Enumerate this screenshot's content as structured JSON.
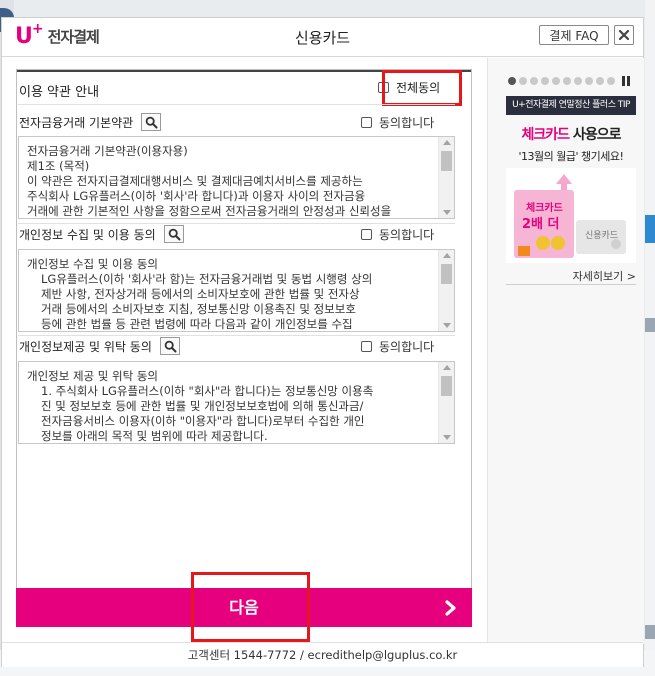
{
  "header": {
    "logo_u": "U",
    "logo_plus": "+",
    "logo_text": "전자결제",
    "title": "신용카드",
    "faq_label": "결제 FAQ"
  },
  "terms": {
    "section_title": "이용 약관 안내",
    "all_agree_label": "전체동의",
    "items": [
      {
        "title": "전자금융거래 기본약관",
        "agree_label": "동의합니다",
        "lines": [
          "전자금융거래 기본약관(이용자용)",
          "제1조 (목적)",
          "이 약관은 전자지급결제대행서비스 및 결제대금예치서비스를 제공하는",
          "주식회사 LG유플러스(이하 '회사'라 합니다)과 이용자 사이의 전자금융",
          "거래에 관한 기본적인 사항을 정함으로써 전자금융거래의 안정성과 신뢰성을"
        ]
      },
      {
        "title": "개인정보 수집 및 이용 동의",
        "agree_label": "동의합니다",
        "lines": [
          "개인정보 수집 및 이용 동의",
          "LG유플러스(이하 '회사'라 함)는 전자금융거래법 및 동법 시행령 상의",
          "제반 사항, 전자상거래 등에서의 소비자보호에 관한 법률 및 전자상",
          "거래 등에서의 소비자보호 지침, 정보통신망 이용촉진 및 정보보호",
          "등에 관한 법률 등 관련 법령에 따라 다음과 같이 개인정보를 수집"
        ]
      },
      {
        "title": "개인정보제공 및 위탁 동의",
        "agree_label": "동의합니다",
        "lines": [
          "개인정보 제공 및 위탁 동의",
          "1. 주식회사 LG유플러스(이하 \"회사\"라 합니다)는 정보통신망 이용촉",
          "진 및 정보보호 등에 관한 법률 및 개인정보보호법에 의해 통신과금/",
          "전자금융서비스 이용자(이하 \"이용자\"라 합니다)로부터 수집한 개인",
          "정보를 아래의 목적 및 범위에 따라 제공합니다."
        ]
      }
    ]
  },
  "next_button": {
    "label": "다음"
  },
  "sidebar": {
    "tip_banner": "U+전자결제 연말정산 플러스 TIP",
    "promo_line1_highlight": "체크카드",
    "promo_line1_rest": " 사용으로",
    "promo_line2": "'13월의 월급' 챙기세요!",
    "card_label_1": "체크카드",
    "card_label_2": "2배 더",
    "card_label_3": "신용카드",
    "detail_link": "자세히보기 >",
    "carousel_total": 10,
    "carousel_active": 1
  },
  "footer": {
    "text": "고객센터 1544-7772 / ecredithelp@lguplus.co.kr"
  },
  "colors": {
    "brand": "#e6007e",
    "highlight_box": "#e6161d",
    "banner_dark": "#2b2e3c"
  }
}
